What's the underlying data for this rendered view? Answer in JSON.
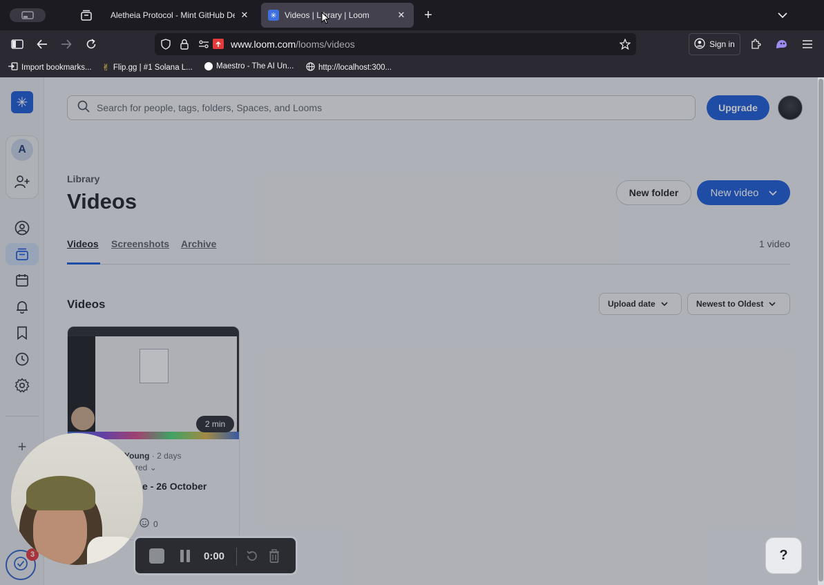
{
  "browser": {
    "tabs": [
      {
        "title": "Aletheia Protocol - Mint GitHub Dev",
        "close": "✕"
      },
      {
        "title": "Videos | Library | Loom",
        "close": "✕"
      }
    ],
    "new_tab": "+",
    "url_domain": "www.loom.com",
    "url_path": "/looms/videos",
    "sign_in": "Sign in",
    "bookmarks": [
      {
        "label": "Import bookmarks..."
      },
      {
        "label": "Flip.gg | #1 Solana L..."
      },
      {
        "label": "Maestro - The AI Un..."
      },
      {
        "label": "http://localhost:300..."
      }
    ]
  },
  "app": {
    "workspace_initial": "A",
    "search_placeholder": "Search for people, tags, folders, Spaces, and Looms",
    "upgrade": "Upgrade",
    "breadcrumb": "Library",
    "page_title": "Videos",
    "new_folder": "New folder",
    "new_video": "New video",
    "tabs": [
      "Videos",
      "Screenshots",
      "Archive"
    ],
    "video_count": "1 video",
    "section_title": "Videos",
    "sort_field": "Upload date",
    "sort_order": "Newest to Oldest",
    "card": {
      "duration": "2 min",
      "author": "Young",
      "age": "· 2 days",
      "shared": "red",
      "title": "e - 26 October",
      "reactions": "0"
    },
    "notif_count": "3",
    "help": "?"
  },
  "recorder": {
    "time": "0:00"
  },
  "colors": {
    "accent": "#1c5bd6",
    "notification": "#e0393e"
  }
}
